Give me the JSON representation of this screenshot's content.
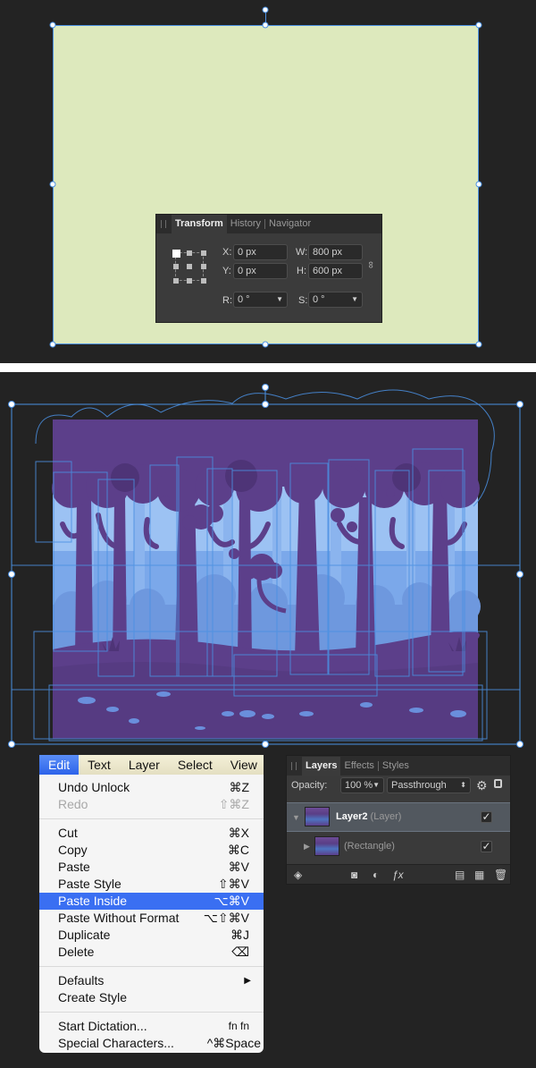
{
  "transform_panel": {
    "tabs": [
      "Transform",
      "History",
      "Navigator"
    ],
    "fields": {
      "x_label": "X:",
      "x_value": "0 px",
      "y_label": "Y:",
      "y_value": "0 px",
      "w_label": "W:",
      "w_value": "800 px",
      "h_label": "H:",
      "h_value": "600 px",
      "r_label": "R:",
      "r_value": "0 °",
      "s_label": "S:",
      "s_value": "0 °"
    }
  },
  "colors": {
    "canvas_bg": "#232323",
    "document_fill": "#dde9bd",
    "selection_blue": "#4a90e2",
    "menu_highlight": "#3a6ff2",
    "scene_purple": "#5c3f8a",
    "scene_blue": "#7ba8ea"
  },
  "menubar": {
    "items": [
      "Edit",
      "Text",
      "Layer",
      "Select",
      "View"
    ],
    "active": "Edit"
  },
  "edit_menu": {
    "groups": [
      [
        {
          "label": "Undo Unlock",
          "shortcut": "⌘Z"
        },
        {
          "label": "Redo",
          "shortcut": "⇧⌘Z",
          "disabled": true
        }
      ],
      [
        {
          "label": "Cut",
          "shortcut": "⌘X"
        },
        {
          "label": "Copy",
          "shortcut": "⌘C"
        },
        {
          "label": "Paste",
          "shortcut": "⌘V"
        },
        {
          "label": "Paste Style",
          "shortcut": "⇧⌘V"
        },
        {
          "label": "Paste Inside",
          "shortcut": "⌥⌘V",
          "highlighted": true
        },
        {
          "label": "Paste Without Format",
          "shortcut": "⌥⇧⌘V"
        },
        {
          "label": "Duplicate",
          "shortcut": "⌘J"
        },
        {
          "label": "Delete",
          "shortcut": "⌫"
        }
      ],
      [
        {
          "label": "Defaults",
          "submenu": true
        },
        {
          "label": "Create Style",
          "shortcut": ""
        }
      ],
      [
        {
          "label": "Start Dictation...",
          "shortcut": "fn fn"
        },
        {
          "label": "Special Characters...",
          "shortcut": "^⌘Space"
        }
      ]
    ]
  },
  "layers_panel": {
    "tabs": [
      "Layers",
      "Effects",
      "Styles"
    ],
    "opacity_label": "Opacity:",
    "opacity_value": "100 %",
    "blend_mode": "Passthrough",
    "layers": [
      {
        "name": "Layer2",
        "type": "(Layer)",
        "visible": true,
        "selected": true
      },
      {
        "name": "",
        "type": "(Rectangle)",
        "visible": true,
        "selected": false
      }
    ],
    "toolbar_icons": [
      "layers-stack-icon",
      "mask-icon",
      "adjustment-icon",
      "fx-icon",
      "new-document-icon",
      "group-icon",
      "trash-icon"
    ]
  }
}
